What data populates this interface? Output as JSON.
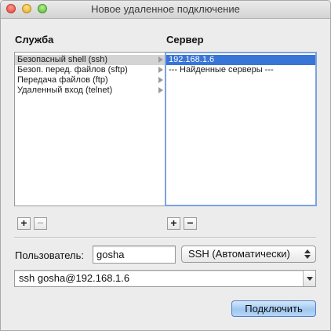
{
  "window": {
    "title": "Новое удаленное подключение"
  },
  "services": {
    "label": "Служба",
    "items": [
      {
        "label": "Безопасный shell (ssh)",
        "selected": true
      },
      {
        "label": "Безоп. перед. файлов (sftp)",
        "selected": false
      },
      {
        "label": "Передача файлов (ftp)",
        "selected": false
      },
      {
        "label": "Удаленный вход (telnet)",
        "selected": false
      }
    ],
    "add_label": "+",
    "remove_label": "−"
  },
  "servers": {
    "label": "Сервер",
    "items": [
      {
        "label": "192.168.1.6",
        "selected": true
      },
      {
        "label": "--- Найденные серверы ---",
        "selected": false
      }
    ],
    "add_label": "+",
    "remove_label": "−"
  },
  "user": {
    "label": "Пользователь:",
    "value": "gosha"
  },
  "protocol": {
    "value": "SSH (Автоматически)"
  },
  "command": {
    "value": "ssh gosha@192.168.1.6"
  },
  "connect_button": {
    "label": "Подключить"
  },
  "colors": {
    "selection_blue": "#3875d7",
    "selection_gray": "#d4d4d4",
    "window_bg": "#ececec"
  }
}
